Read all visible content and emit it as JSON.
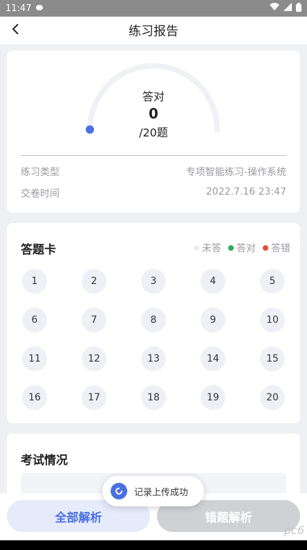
{
  "status_bar": {
    "time": "11:47"
  },
  "header": {
    "title": "练习报告"
  },
  "report": {
    "correct_label": "答对",
    "correct_count": "0",
    "total": "/20题",
    "progress_fraction": 0,
    "type_label": "练习类型",
    "type_value": "专项智能练习-操作系统",
    "time_label": "交卷时间",
    "time_value": "2022.7.16 23:47",
    "colors": {
      "track": "#f0f1f4",
      "dot": "#4b70e3"
    }
  },
  "answer_card": {
    "title": "答题卡",
    "legend": [
      {
        "label": "未答",
        "color": "#eeeeee"
      },
      {
        "label": "答对",
        "color": "#27ae60"
      },
      {
        "label": "答错",
        "color": "#e74c3c"
      }
    ],
    "questions": [
      "1",
      "2",
      "3",
      "4",
      "5",
      "6",
      "7",
      "8",
      "9",
      "10",
      "11",
      "12",
      "13",
      "14",
      "15",
      "16",
      "17",
      "18",
      "19",
      "20"
    ]
  },
  "exam": {
    "title": "考试情况"
  },
  "toast": {
    "text": "记录上传成功"
  },
  "buttons": {
    "all": "全部解析",
    "wrong": "错题解析"
  },
  "colors": {
    "accent": "#4b70e3",
    "background": "#eef0f4"
  },
  "watermark": "pc6"
}
